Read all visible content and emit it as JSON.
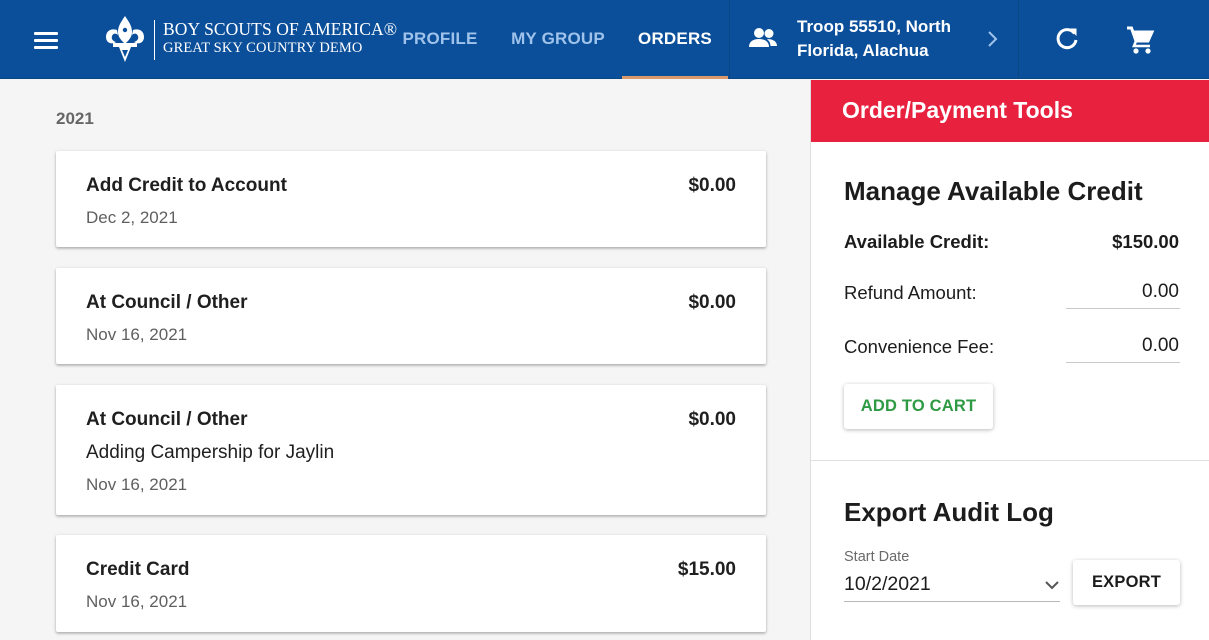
{
  "header": {
    "logo_line1": "BOY SCOUTS OF AMERICA®",
    "logo_line2": "GREAT SKY COUNTRY DEMO",
    "nav": [
      {
        "label": "PROFILE",
        "active": false
      },
      {
        "label": "MY GROUP",
        "active": false
      },
      {
        "label": "ORDERS",
        "active": true
      }
    ],
    "troop": "Troop 55510, North Florida, Alachua",
    "icons": [
      "menu-icon",
      "fleur-de-lis-logo",
      "group-icon",
      "chevron-right-icon",
      "refresh-icon",
      "cart-icon"
    ],
    "colors": {
      "bar": "#0b4f9a",
      "active_underline": "#d9996b",
      "inactive_tab": "#9fc3ea"
    }
  },
  "orders": {
    "year": "2021",
    "items": [
      {
        "title": "Add Credit to Account",
        "amount": "$0.00",
        "note": "",
        "date": "Dec 2, 2021"
      },
      {
        "title": "At Council / Other",
        "amount": "$0.00",
        "note": "",
        "date": "Nov 16, 2021"
      },
      {
        "title": "At Council / Other",
        "amount": "$0.00",
        "note": "Adding Campership for Jaylin",
        "date": "Nov 16, 2021"
      },
      {
        "title": "Credit Card",
        "amount": "$15.00",
        "note": "",
        "date": "Nov 16, 2021"
      }
    ]
  },
  "tools": {
    "header": "Order/Payment Tools",
    "header_color": "#e8213f",
    "credit": {
      "title": "Manage Available Credit",
      "available_label": "Available Credit:",
      "available_value": "$150.00",
      "refund_label": "Refund Amount:",
      "refund_value": "0.00",
      "fee_label": "Convenience Fee:",
      "fee_value": "0.00",
      "add_to_cart": "ADD TO CART",
      "add_to_cart_color": "#2e9a44"
    },
    "audit": {
      "title": "Export Audit Log",
      "start_date_label": "Start Date",
      "start_date_value": "10/2/2021",
      "export_label": "EXPORT"
    }
  }
}
